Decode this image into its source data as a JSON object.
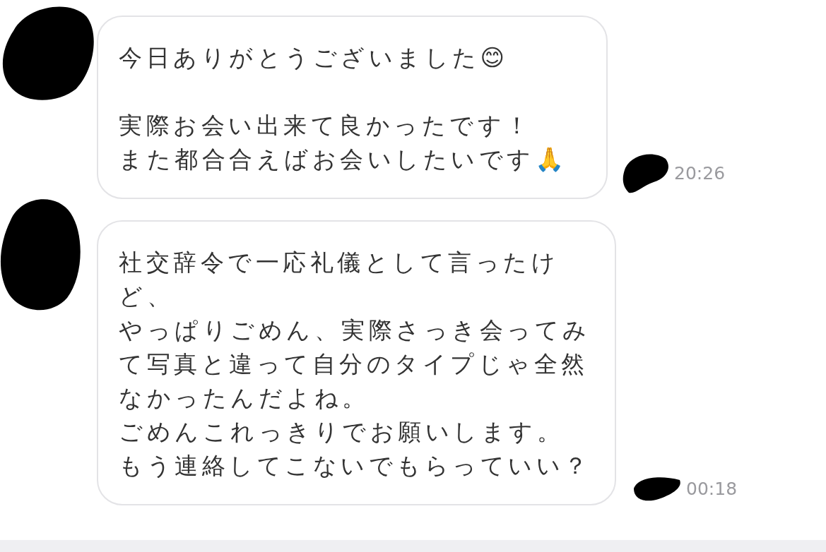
{
  "messages": [
    {
      "paragraphs": [
        [
          "今日ありがとうございました😊"
        ],
        [
          "実際お会い出来て良かったです！",
          "また都合合えばお会いしたいです🙏"
        ]
      ],
      "time": "20:26"
    },
    {
      "paragraphs": [
        [
          "社交辞令で一応礼儀として言ったけど、",
          "やっぱりごめん、実際さっき会ってみて写真と違って自分のタイプじゃ全然なかったんだよね。",
          "ごめんこれっきりでお願いします。",
          "もう連絡してこないでもらっていい？"
        ]
      ],
      "time": "00:18"
    }
  ]
}
